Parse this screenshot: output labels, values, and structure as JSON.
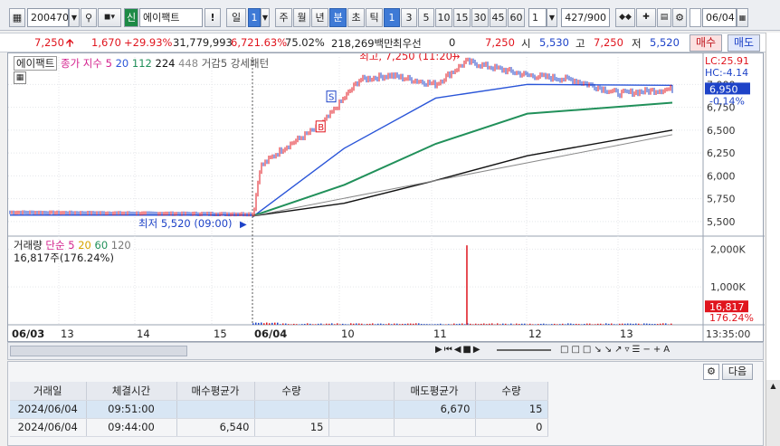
{
  "toolbar": {
    "code": "200470",
    "tag": "신",
    "name": "에이팩트",
    "warn": "!",
    "periods": [
      "일",
      "주",
      "월",
      "년",
      "분",
      "초",
      "틱"
    ],
    "period_sel_value": "1",
    "intervals": [
      "1",
      "3",
      "5",
      "10",
      "15",
      "30",
      "45",
      "60"
    ],
    "count_value": "1",
    "range_value": "427/900",
    "date_value": "06/04"
  },
  "quote": {
    "price": "7,250",
    "change": "1,670",
    "rate": "+29.93%",
    "volume": "31,779,993",
    "vol_ratio": "6,721.63%",
    "turnover_rate": "75.02%",
    "amount": "218,269백만",
    "best_label": "최우선",
    "best_value": "0",
    "best_price": "7,250",
    "open_label": "시",
    "open": "5,530",
    "high_label": "고",
    "high": "7,250",
    "low_label": "저",
    "low": "5,520",
    "buy_label": "매수",
    "sell_label": "매도"
  },
  "chart": {
    "legend_title": "에이팩트",
    "legend_close": "종가 지수 5",
    "ma_values": [
      "20",
      "112",
      "224",
      "448"
    ],
    "legend_extra": "거감5 강세패턴",
    "lc_label": "LC:25.91",
    "hc_label": "HC:-4.14",
    "max_label": "최고, 7,250 (11:20)",
    "min_label": "최저 5,520 (09:00)",
    "b_marker": "B",
    "s_marker": "S",
    "price_box": "6,950",
    "price_pct": "-0.14%",
    "vol_legend_title": "거래량",
    "vol_legend_ma": "단순 5",
    "vol_ma_values": [
      "20",
      "60",
      "120"
    ],
    "vol_current": "16,817주(176.24%)",
    "vol_box": "16,817",
    "vol_pct": "176.24%",
    "time_current": "13:35:00"
  },
  "chart_data": {
    "type": "line",
    "title": "에이팩트",
    "price_ticks": [
      "7,000",
      "6,750",
      "6,500",
      "6,250",
      "6,000",
      "5,750",
      "5,500"
    ],
    "volume_ticks": [
      "2,000K",
      "1,000K"
    ],
    "x_ticks": [
      "06/03",
      "13",
      "14",
      "15",
      "06/04",
      "10",
      "11",
      "12",
      "13"
    ],
    "ylim": [
      5400,
      7300
    ],
    "series": [
      {
        "name": "종가",
        "x": [
          "06/03 09:00",
          "06/03 15:30",
          "06/04 09:00",
          "06/04 09:05",
          "06/04 09:20",
          "06/04 09:44",
          "06/04 09:51",
          "06/04 10:10",
          "06/04 10:30",
          "06/04 11:00",
          "06/04 11:20",
          "06/04 12:00",
          "06/04 12:30",
          "06/04 13:00",
          "06/04 13:35"
        ],
        "values": [
          5600,
          5580,
          5520,
          6100,
          6300,
          6540,
          6670,
          7050,
          7100,
          7000,
          7250,
          7100,
          7050,
          6900,
          6950
        ]
      },
      {
        "name": "20",
        "x": [
          "06/04 09:00",
          "06/04 10:00",
          "06/04 11:00",
          "06/04 12:00",
          "06/04 13:35"
        ],
        "values": [
          5550,
          6300,
          6850,
          7000,
          6990
        ]
      },
      {
        "name": "112",
        "x": [
          "06/04 09:00",
          "06/04 10:00",
          "06/04 11:00",
          "06/04 12:00",
          "06/04 13:35"
        ],
        "values": [
          5560,
          5900,
          6350,
          6680,
          6800
        ]
      },
      {
        "name": "224",
        "x": [
          "06/03 15:30",
          "06/04 10:00",
          "06/04 11:00",
          "06/04 12:00",
          "06/04 13:35"
        ],
        "values": [
          5560,
          5700,
          5950,
          6220,
          6500
        ]
      }
    ],
    "volume_spike": {
      "x": "06/04 11:20",
      "value": 2100
    }
  },
  "orders": {
    "headers": [
      "거래일",
      "체결시간",
      "매수평균가",
      "수량",
      "",
      "매도평균가",
      "수량"
    ],
    "rows": [
      {
        "date": "2024/06/04",
        "time": "09:51:00",
        "buy_avg": "",
        "buy_qty": "",
        "blank": "",
        "sell_avg": "6,670",
        "sell_qty": "15"
      },
      {
        "date": "2024/06/04",
        "time": "09:44:00",
        "buy_avg": "6,540",
        "buy_qty": "15",
        "blank": "",
        "sell_avg": "",
        "sell_qty": "0"
      }
    ],
    "next_label": "다음"
  },
  "colors": {
    "candle_up": "#e0151e",
    "candle_down": "#1e43c8",
    "ma20": "#2a55d8",
    "ma112": "#21905a",
    "ma224": "#111111",
    "ma448": "#8a8a8a",
    "accent": "#3e7ad6"
  }
}
